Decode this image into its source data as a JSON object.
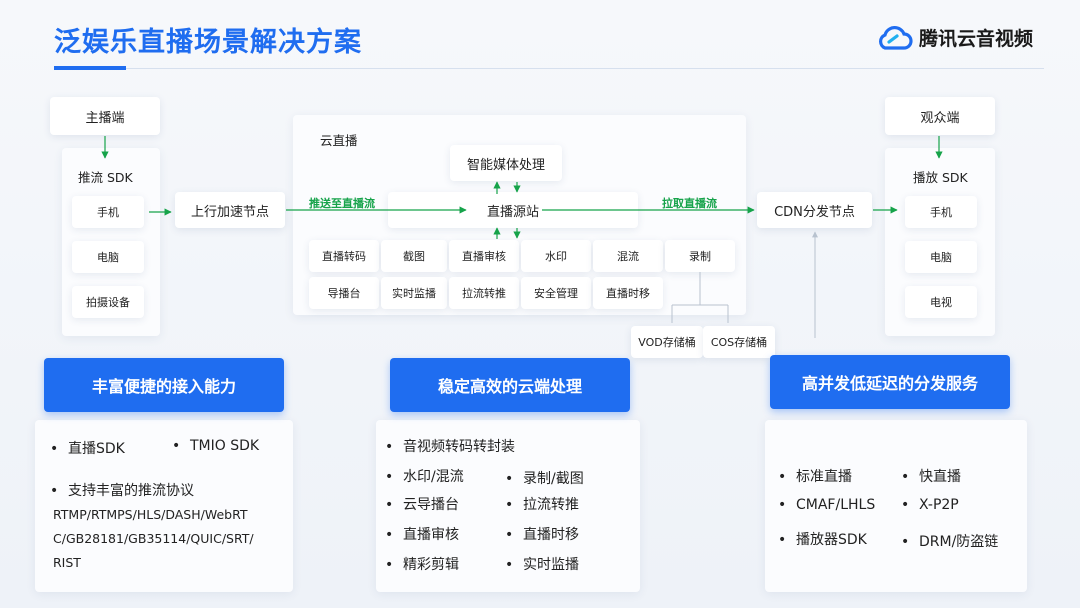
{
  "title": "泛娱乐直播场景解决方案",
  "logo": {
    "text": "腾讯云音视频",
    "icon": "cloud-logo-icon",
    "color": "#1f6df0"
  },
  "anchor": {
    "header": "主播端",
    "sdk": "推流 SDK",
    "devices": [
      "手机",
      "电脑",
      "拍摄设备"
    ]
  },
  "uplink": "上行加速节点",
  "labels": {
    "push": "推送至直播流",
    "pull": "拉取直播流"
  },
  "cloud": {
    "title": "云直播",
    "media": "智能媒体处理",
    "origin": "直播源站",
    "row1": [
      "直播转码",
      "截图",
      "直播审核",
      "水印",
      "混流",
      "录制"
    ],
    "row2": [
      "导播台",
      "实时监播",
      "拉流转推",
      "安全管理",
      "直播时移"
    ]
  },
  "storage": [
    "VOD存储桶",
    "COS存储桶"
  ],
  "cdn": "CDN分发节点",
  "viewer": {
    "header": "观众端",
    "sdk": "播放 SDK",
    "devices": [
      "手机",
      "电脑",
      "电视"
    ]
  },
  "features": {
    "left": {
      "title": "丰富便捷的接入能力",
      "items": [
        "直播SDK",
        "TMIO SDK",
        "支持丰富的推流协议"
      ],
      "protocols": [
        "RTMP/RTMPS/HLS/DASH/WebRT",
        "C/GB28181/GB35114/QUIC/SRT/",
        "RIST"
      ]
    },
    "mid": {
      "title": "稳定高效的云端处理",
      "items": [
        "音视频转码转封装",
        "水印/混流",
        "录制/截图",
        "云导播台",
        "拉流转推",
        "直播审核",
        "直播时移",
        "精彩剪辑",
        "实时监播"
      ]
    },
    "right": {
      "title": "高并发低延迟的分发服务",
      "items": [
        "标准直播",
        "快直播",
        "CMAF/LHLS",
        "X-P2P",
        "播放器SDK",
        "DRM/防盗链"
      ]
    }
  },
  "colors": {
    "accent": "#1f6df0",
    "arrow": "#16a34a"
  }
}
